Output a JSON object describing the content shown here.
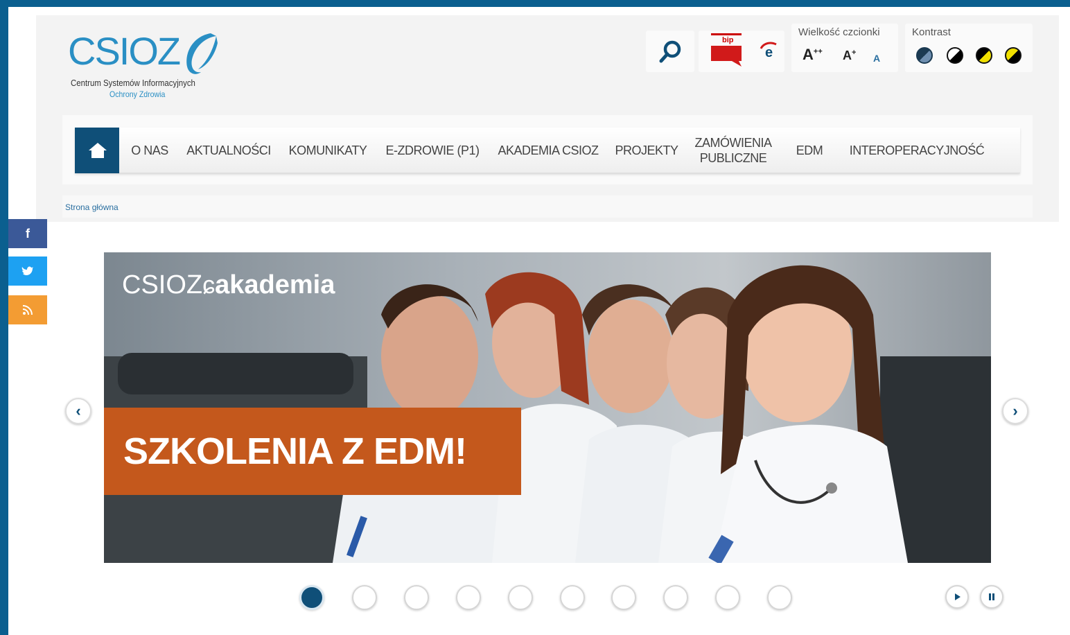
{
  "logo": {
    "name": "CSIOZ",
    "subtitle_line1": "Centrum Systemów Informacyjnych",
    "subtitle_line2": "Ochrony Zdrowia"
  },
  "tools": {
    "search_icon": "search-icon",
    "bip_label": "bip",
    "font_size_label": "Wielkość czcionki",
    "font_large": "A",
    "font_large_sup": "++",
    "font_medium": "A",
    "font_medium_sup": "+",
    "font_small": "A",
    "contrast_label": "Kontrast",
    "contrast_options": [
      "default",
      "black-white",
      "black-yellow",
      "yellow-black"
    ]
  },
  "nav": {
    "home_icon": "home-icon",
    "items": [
      {
        "label": "O NAS"
      },
      {
        "label": "AKTUALNOŚCI"
      },
      {
        "label": "KOMUNIKATY"
      },
      {
        "label": "E-ZDROWIE (P1)"
      },
      {
        "label": "AKADEMIA CSIOZ"
      },
      {
        "label": "PROJEKTY"
      },
      {
        "label": "ZAMÓWIENIA PUBLICZNE"
      },
      {
        "label": "EDM"
      },
      {
        "label": "INTEROPERACYJNOŚĆ"
      }
    ]
  },
  "breadcrumb": {
    "label": "Strona główna"
  },
  "social": [
    "facebook-icon",
    "twitter-icon",
    "rss-icon"
  ],
  "slider": {
    "brand_prefix": "CSIOZ",
    "brand_suffix": "akademia",
    "headline": "SZKOLENIA Z EDM!",
    "total_slides": 10,
    "active_slide": 1
  },
  "colors": {
    "frame": "#0b5f8f",
    "primary": "#0f4f78",
    "logo_blue": "#2a8fc4",
    "banner_orange": "#c4581c",
    "facebook": "#3b5998",
    "twitter": "#1da1f2",
    "rss": "#f39c33"
  }
}
